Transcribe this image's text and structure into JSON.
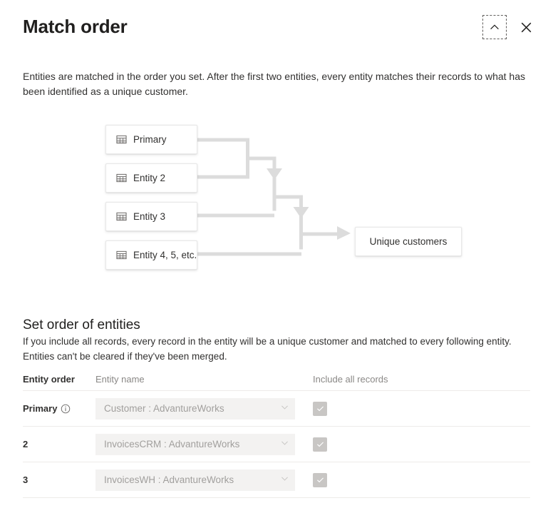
{
  "header": {
    "title": "Match order",
    "collapse_icon": "chevron-up-icon",
    "close_icon": "close-icon"
  },
  "intro": "Entities are matched in the order you set. After the first two entities, every entity matches their records to what has been identified as a unique customer.",
  "diagram": {
    "nodes": [
      {
        "label": "Primary",
        "icon": "table-grid-icon"
      },
      {
        "label": "Entity 2",
        "icon": "table-grid-icon"
      },
      {
        "label": "Entity 3",
        "icon": "table-grid-icon"
      },
      {
        "label": "Entity 4, 5, etc.",
        "icon": "table-grid-icon"
      }
    ],
    "result": {
      "label": "Unique customers"
    },
    "connector_color": "#dcdcdc"
  },
  "section": {
    "heading": "Set order of entities",
    "description": "If you include all records, every record in the entity will be a unique customer and matched to every following entity. Entities can't be cleared if they've been merged."
  },
  "table": {
    "columns": {
      "order": "Entity order",
      "name": "Entity name",
      "include": "Include all records"
    },
    "rows": [
      {
        "order": "Primary",
        "has_info_icon": true,
        "entity": "Customer : AdvantureWorks",
        "include_all": true
      },
      {
        "order": "2",
        "has_info_icon": false,
        "entity": "InvoicesCRM : AdvantureWorks",
        "include_all": true
      },
      {
        "order": "3",
        "has_info_icon": false,
        "entity": "InvoicesWH : AdvantureWorks",
        "include_all": true
      }
    ]
  }
}
